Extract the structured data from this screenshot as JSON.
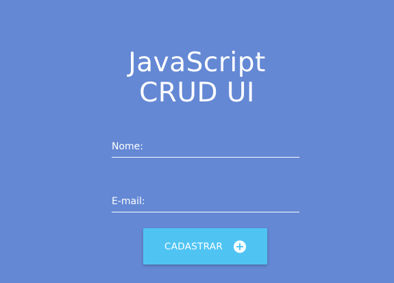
{
  "header": {
    "title_line1": "JavaScript",
    "title_line2": "CRUD UI"
  },
  "form": {
    "nome_placeholder": "Nome:",
    "nome_value": "",
    "email_placeholder": "E-mail:",
    "email_value": "",
    "submit_label": "CADASTRAR",
    "submit_icon": "plus-circle-icon"
  },
  "colors": {
    "background": "#6488d4",
    "button": "#4fc4f3",
    "text": "#ffffff"
  }
}
